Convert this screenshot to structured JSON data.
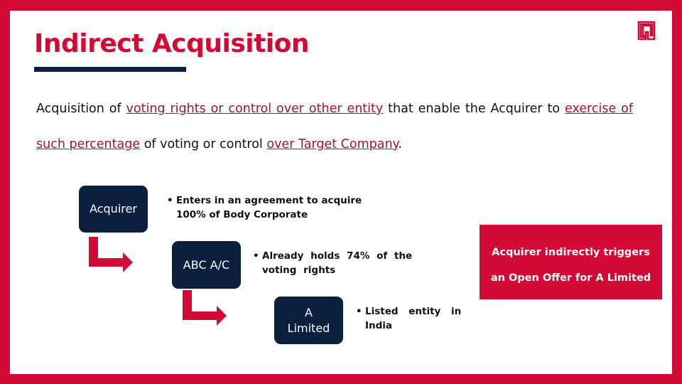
{
  "slide": {
    "title": "Indirect Acquisition",
    "logo_icon": "brand-square-logo-icon",
    "definition": {
      "segments": [
        {
          "text": "Acquisition of ",
          "underlined": false
        },
        {
          "text": "voting rights or control over other entity",
          "underlined": true
        },
        {
          "text": " that enable the Acquirer to ",
          "underlined": false
        },
        {
          "text": "exercise of such percentage",
          "underlined": true
        },
        {
          "text": " of voting or control ",
          "underlined": false
        },
        {
          "text": "over Target Company",
          "underlined": true
        },
        {
          "text": ".",
          "underlined": false
        }
      ]
    },
    "flow": [
      {
        "entity": "Acquirer",
        "note": "Enters in an agreement to acquire 100% of Body Corporate"
      },
      {
        "entity": "ABC A/C",
        "note": "Already holds 74% of the voting rights"
      },
      {
        "entity": "A Limited",
        "note": "Listed entity in India"
      }
    ],
    "bullet_glyph": "•",
    "arrow_icon": "elbow-arrow-icon",
    "callout": {
      "line1": "Acquirer indirectly triggers",
      "line2": "an Open Offer for A Limited"
    },
    "colors": {
      "brand_red": "#d20a35",
      "navy": "#0b1f3f",
      "link_red": "#a0133d"
    }
  }
}
